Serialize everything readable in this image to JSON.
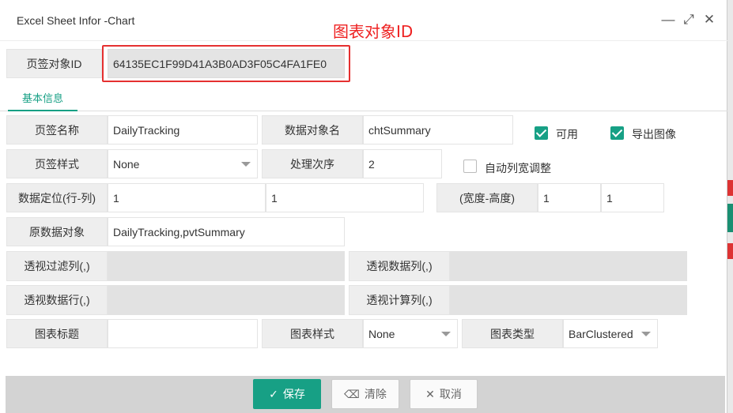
{
  "window": {
    "title": "Excel Sheet Infor -Chart",
    "minimize_glyph": "—",
    "maximize_glyph": "⤢",
    "close_glyph": "✕"
  },
  "annotation": {
    "text": "图表对象ID",
    "color": "#ee2222"
  },
  "sheet_object_id": {
    "label": "页签对象ID",
    "value": "64135EC1F99D41A3B0AD3F05C4FA1FE0"
  },
  "tabs": [
    {
      "label": "基本信息",
      "active": true
    }
  ],
  "form": {
    "sheet_name": {
      "label": "页签名称",
      "value": "DailyTracking"
    },
    "data_object_name": {
      "label": "数据对象名",
      "value": "chtSummary"
    },
    "enabled": {
      "label": "可用",
      "checked": true
    },
    "export_image": {
      "label": "导出图像",
      "checked": true
    },
    "sheet_style": {
      "label": "页签样式",
      "value": "None"
    },
    "process_order": {
      "label": "处理次序",
      "value": "2"
    },
    "auto_col_width": {
      "label": "自动列宽调整",
      "checked": false
    },
    "data_position": {
      "label": "数据定位(行-列)",
      "row": "1",
      "col": "1"
    },
    "size": {
      "label": "(宽度-高度)",
      "width": "1",
      "height": "1"
    },
    "source_object": {
      "label": "原数据对象",
      "value": "DailyTracking,pvtSummary"
    },
    "pivot_filter_cols": {
      "label": "透视过滤列(,)",
      "value": ""
    },
    "pivot_data_cols": {
      "label": "透视数据列(,)",
      "value": ""
    },
    "pivot_data_rows": {
      "label": "透视数据行(,)",
      "value": ""
    },
    "pivot_calc_cols": {
      "label": "透视计算列(,)",
      "value": ""
    },
    "chart_title": {
      "label": "图表标题",
      "value": ""
    },
    "chart_style": {
      "label": "图表样式",
      "value": "None"
    },
    "chart_type": {
      "label": "图表类型",
      "value": "BarClustered"
    }
  },
  "footer": {
    "save_label": "保存",
    "clear_label": "清除",
    "cancel_label": "取消",
    "save_icon": "checkmark-icon",
    "clear_icon": "eraser-icon",
    "cancel_icon": "close-icon"
  },
  "colors": {
    "accent": "#17a085",
    "annotation": "#ee2222",
    "field_gray": "#e2e2e2"
  }
}
